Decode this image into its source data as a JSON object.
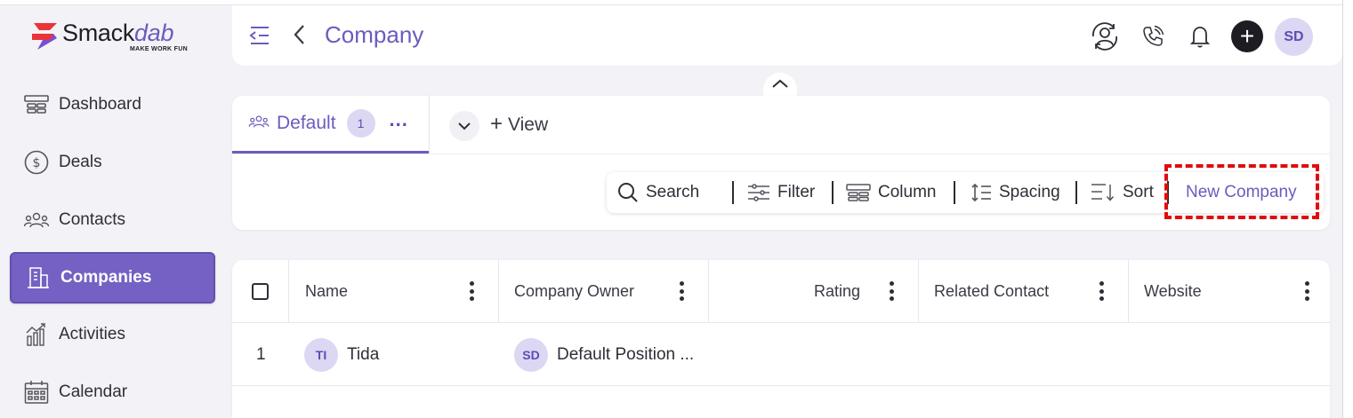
{
  "brand": {
    "name_main": "Smack",
    "name_accent": "dab",
    "tagline": "MAKE WORK FUN"
  },
  "sidebar": {
    "items": [
      {
        "label": "Dashboard",
        "icon": "dashboard-icon",
        "active": false
      },
      {
        "label": "Deals",
        "icon": "dollar-icon",
        "active": false
      },
      {
        "label": "Contacts",
        "icon": "contacts-icon",
        "active": false
      },
      {
        "label": "Companies",
        "icon": "building-icon",
        "active": true
      },
      {
        "label": "Activities",
        "icon": "activities-icon",
        "active": false
      },
      {
        "label": "Calendar",
        "icon": "calendar-icon",
        "active": false
      }
    ]
  },
  "header": {
    "title": "Company",
    "avatar_initials": "SD",
    "icons": [
      "collapse-menu-icon",
      "back-icon",
      "user-sync-icon",
      "phone-icon",
      "bell-icon",
      "plus-icon"
    ]
  },
  "views": {
    "active_tab": {
      "label": "Default",
      "count": "1"
    },
    "add_view_label": "View"
  },
  "toolbar": {
    "search_label": "Search",
    "filter_label": "Filter",
    "column_label": "Column",
    "spacing_label": "Spacing",
    "sort_label": "Sort",
    "new_company_label": "New Company"
  },
  "table": {
    "columns": [
      "Name",
      "Company Owner",
      "Rating",
      "Related Contact",
      "Website"
    ],
    "rows": [
      {
        "index": "1",
        "name_initials": "TI",
        "name": "Tida",
        "owner_initials": "SD",
        "owner": "Default Position ...",
        "rating": "",
        "related_contact": "",
        "website": ""
      }
    ]
  },
  "colors": {
    "accent": "#6a5cbd",
    "active_nav": "#7461c3",
    "highlight_box": "#e00d0d",
    "avatar_bg": "#dcd7f2"
  }
}
